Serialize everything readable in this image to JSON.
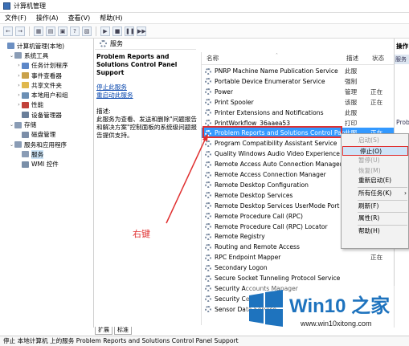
{
  "window": {
    "title": "计算机管理"
  },
  "menu": [
    "文件(F)",
    "操作(A)",
    "查看(V)",
    "帮助(H)"
  ],
  "toolbar_glyphs": [
    "←",
    "→",
    "▦",
    "▤",
    "▣",
    "?",
    "▧",
    "▶",
    "■",
    "❚❚",
    "▶▶"
  ],
  "tree": [
    {
      "label": "计算机管理(本地)",
      "indent": 0,
      "exp": "",
      "color": "#6c8fc2"
    },
    {
      "label": "系统工具",
      "indent": 1,
      "exp": "⌄",
      "color": "#8a9cb5"
    },
    {
      "label": "任务计划程序",
      "indent": 2,
      "exp": "›",
      "color": "#5d87c8"
    },
    {
      "label": "事件查看器",
      "indent": 2,
      "exp": "›",
      "color": "#c9a14a"
    },
    {
      "label": "共享文件夹",
      "indent": 2,
      "exp": "›",
      "color": "#e0b84d"
    },
    {
      "label": "本地用户和组",
      "indent": 2,
      "exp": "›",
      "color": "#6b8fb5"
    },
    {
      "label": "性能",
      "indent": 2,
      "exp": "›",
      "color": "#c2413a"
    },
    {
      "label": "设备管理器",
      "indent": 2,
      "exp": "",
      "color": "#6a7f9a"
    },
    {
      "label": "存储",
      "indent": 1,
      "exp": "⌄",
      "color": "#8a9cb5"
    },
    {
      "label": "磁盘管理",
      "indent": 2,
      "exp": "",
      "color": "#7c8ea8"
    },
    {
      "label": "服务和应用程序",
      "indent": 1,
      "exp": "⌄",
      "color": "#8a9cb5"
    },
    {
      "label": "服务",
      "indent": 2,
      "exp": "",
      "color": "#8a9cb5",
      "selected": true
    },
    {
      "label": "WMI 控件",
      "indent": 2,
      "exp": "",
      "color": "#7a8fa8"
    }
  ],
  "services_header": "服务",
  "detail": {
    "service_name": "Problem Reports and Solutions Control Panel Support",
    "stop_link": "停止此服务",
    "restart_link": "重启动此服务",
    "desc_label": "描述:",
    "desc_text": "此服务为查看、发送和删除\"问题报告和解决方案\"控制面板的系统级问题报告提供支持。"
  },
  "columns": {
    "name": "名称",
    "desc": "描述",
    "status": "状态"
  },
  "services": [
    {
      "name": "PNRP Machine Name Publication Service",
      "desc": "此服",
      "status": ""
    },
    {
      "name": "Portable Device Enumerator Service",
      "desc": "强制",
      "status": ""
    },
    {
      "name": "Power",
      "desc": "管理",
      "status": "正在"
    },
    {
      "name": "Print Spooler",
      "desc": "该服",
      "status": "正在"
    },
    {
      "name": "Printer Extensions and Notifications",
      "desc": "此服",
      "status": ""
    },
    {
      "name": "PrintWorkflow_36aaea53",
      "desc": "打印",
      "status": ""
    },
    {
      "name": "Problem Reports and Solutions Control Pan",
      "desc": "此服",
      "status": "正在",
      "selected": true
    },
    {
      "name": "Program Compatibility Assistant Service",
      "desc": "",
      "status": ""
    },
    {
      "name": "Quality Windows Audio Video Experience",
      "desc": "",
      "status": ""
    },
    {
      "name": "Remote Access Auto Connection Manager",
      "desc": "",
      "status": ""
    },
    {
      "name": "Remote Access Connection Manager",
      "desc": "",
      "status": ""
    },
    {
      "name": "Remote Desktop Configuration",
      "desc": "",
      "status": ""
    },
    {
      "name": "Remote Desktop Services",
      "desc": "",
      "status": ""
    },
    {
      "name": "Remote Desktop Services UserMode Port R",
      "desc": "",
      "status": ""
    },
    {
      "name": "Remote Procedure Call (RPC)",
      "desc": "",
      "status": ""
    },
    {
      "name": "Remote Procedure Call (RPC) Locator",
      "desc": "",
      "status": ""
    },
    {
      "name": "Remote Registry",
      "desc": "",
      "status": ""
    },
    {
      "name": "Routing and Remote Access",
      "desc": "",
      "status": ""
    },
    {
      "name": "RPC Endpoint Mapper",
      "desc": "",
      "status": "正在"
    },
    {
      "name": "Secondary Logon",
      "desc": "",
      "status": ""
    },
    {
      "name": "Secure Socket Tunneling Protocol Service",
      "desc": "",
      "status": ""
    },
    {
      "name": "Security Accounts Manager",
      "desc": "",
      "status": ""
    },
    {
      "name": "Security Center",
      "desc": "",
      "status": ""
    },
    {
      "name": "Sensor Data Service",
      "desc": "",
      "status": ""
    }
  ],
  "actions": {
    "header": "操作",
    "sub": "服务",
    "item": "Prob"
  },
  "context_menu": [
    {
      "label": "启动(S)",
      "disabled": true
    },
    {
      "label": "停止(O)",
      "hover": true
    },
    {
      "label": "暂停(U)",
      "disabled": true
    },
    {
      "label": "恢复(M)",
      "disabled": true
    },
    {
      "label": "重新启动(E)"
    },
    {
      "sep": true
    },
    {
      "label": "所有任务(K)",
      "arrow": "›"
    },
    {
      "sep": true
    },
    {
      "label": "刷新(F)"
    },
    {
      "sep": true
    },
    {
      "label": "属性(R)"
    },
    {
      "sep": true
    },
    {
      "label": "帮助(H)"
    }
  ],
  "annotation": "右键",
  "tabs": [
    "扩展",
    "标准"
  ],
  "status_bar": "停止 本地计算机 上的服务 Problem Reports and Solutions Control Panel Support",
  "watermark": {
    "title": "Win10 之家",
    "url": "www.win10xitong.com"
  },
  "colors": {
    "selection": "#3399ff",
    "highlight_red": "#e03030",
    "brand_blue": "#1e73be"
  }
}
